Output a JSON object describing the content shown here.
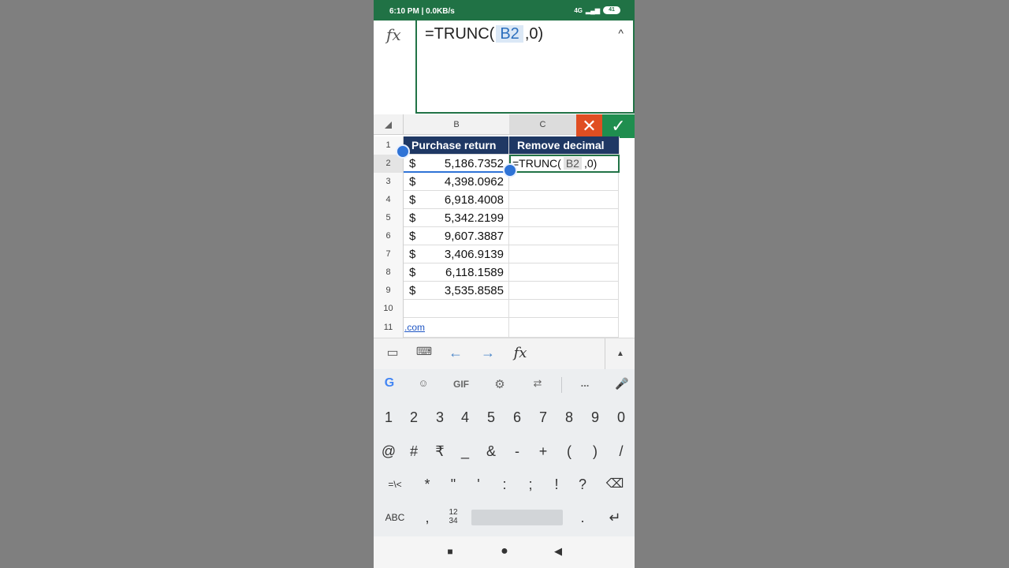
{
  "status": {
    "time": "6:10 PM | 0.0KB/s",
    "signal": "4G",
    "battery": "41"
  },
  "formula_bar": {
    "fx": "fx",
    "prefix": "=TRUNC(",
    "ref": "B2",
    "suffix": ",0)",
    "collapse": "^"
  },
  "columns": [
    "B",
    "C"
  ],
  "actions": {
    "cancel": "✕",
    "confirm": "✓"
  },
  "rows": [
    "1",
    "2",
    "3",
    "4",
    "5",
    "6",
    "7",
    "8",
    "9",
    "10",
    "11"
  ],
  "headers": {
    "b": "Purchase return",
    "c": "Remove decimal"
  },
  "currency": "$",
  "amounts": [
    "5,186.7352",
    "4,398.0962",
    "6,918.4008",
    "5,342.2199",
    "9,607.3887",
    "3,406.9139",
    "6,118.1589",
    "3,535.8585"
  ],
  "edit_cell": {
    "prefix": "=TRUNC(",
    "ref": "B2",
    "suffix": ",0)"
  },
  "link_text": ".com",
  "toolbar": {
    "items": [
      "rename-sheet-icon",
      "keyboard-icon",
      "left-arrow-icon",
      "right-arrow-icon",
      "fx-icon",
      "expand-up-icon"
    ],
    "fx": "fx"
  },
  "suggestions": [
    "G",
    "sticker-icon",
    "GIF",
    "gear-icon",
    "translate-icon",
    "...",
    "mic-icon"
  ],
  "keyboard": {
    "row1": [
      "1",
      "2",
      "3",
      "4",
      "5",
      "6",
      "7",
      "8",
      "9",
      "0"
    ],
    "row2": [
      "@",
      "#",
      "₹",
      "_",
      "&",
      "-",
      "+",
      "(",
      ")",
      "/"
    ],
    "row3": [
      "=\\<",
      "*",
      "\"",
      "'",
      ":",
      ";",
      "!",
      "?",
      "⌫"
    ],
    "row4": [
      "ABC",
      ",",
      "12\n34",
      "."
    ],
    "enter": "↵"
  },
  "nav": [
    "■",
    "●",
    "◀"
  ]
}
